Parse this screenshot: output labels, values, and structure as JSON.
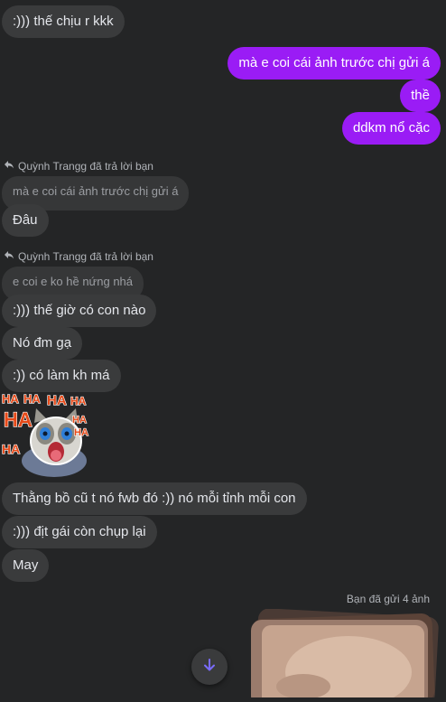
{
  "messages": {
    "m1": ":))) thế chịu r kkk",
    "m2": "mà e coi cái ảnh trước chị gửi á",
    "m3": "thề",
    "m4": "ddkm nổ cặc",
    "reply1_header": "Quỳnh Trangg đã trả lời bạn",
    "reply1_quote": "mà e coi cái ảnh trước chị gửi á",
    "m5": "Đâu",
    "reply2_header": "Quỳnh Trangg đã trả lời bạn",
    "reply2_quote": "e coi e ko hề nứng nhá",
    "m6": ":))) thế giờ có con nào",
    "m7": "Nó đm gạ",
    "m8": ":)) có làm kh má",
    "m9": "Thằng bồ cũ t nó fwb đó :)) nó mỗi tỉnh mỗi con",
    "m10": ":))) địt gái còn chụp lại",
    "m11": "May",
    "sent_note": "Bạn đã gửi 4 ảnh"
  },
  "sticker": {
    "text": "HA",
    "name": "laughing-cat-sticker"
  },
  "icons": {
    "reply": "reply-arrow-icon",
    "scroll": "arrow-down-icon"
  },
  "colors": {
    "background": "#242526",
    "incoming_bubble": "#3a3b3c",
    "outgoing_bubble": "#9a1cf5",
    "scroll_arrow": "#7a6cff"
  }
}
